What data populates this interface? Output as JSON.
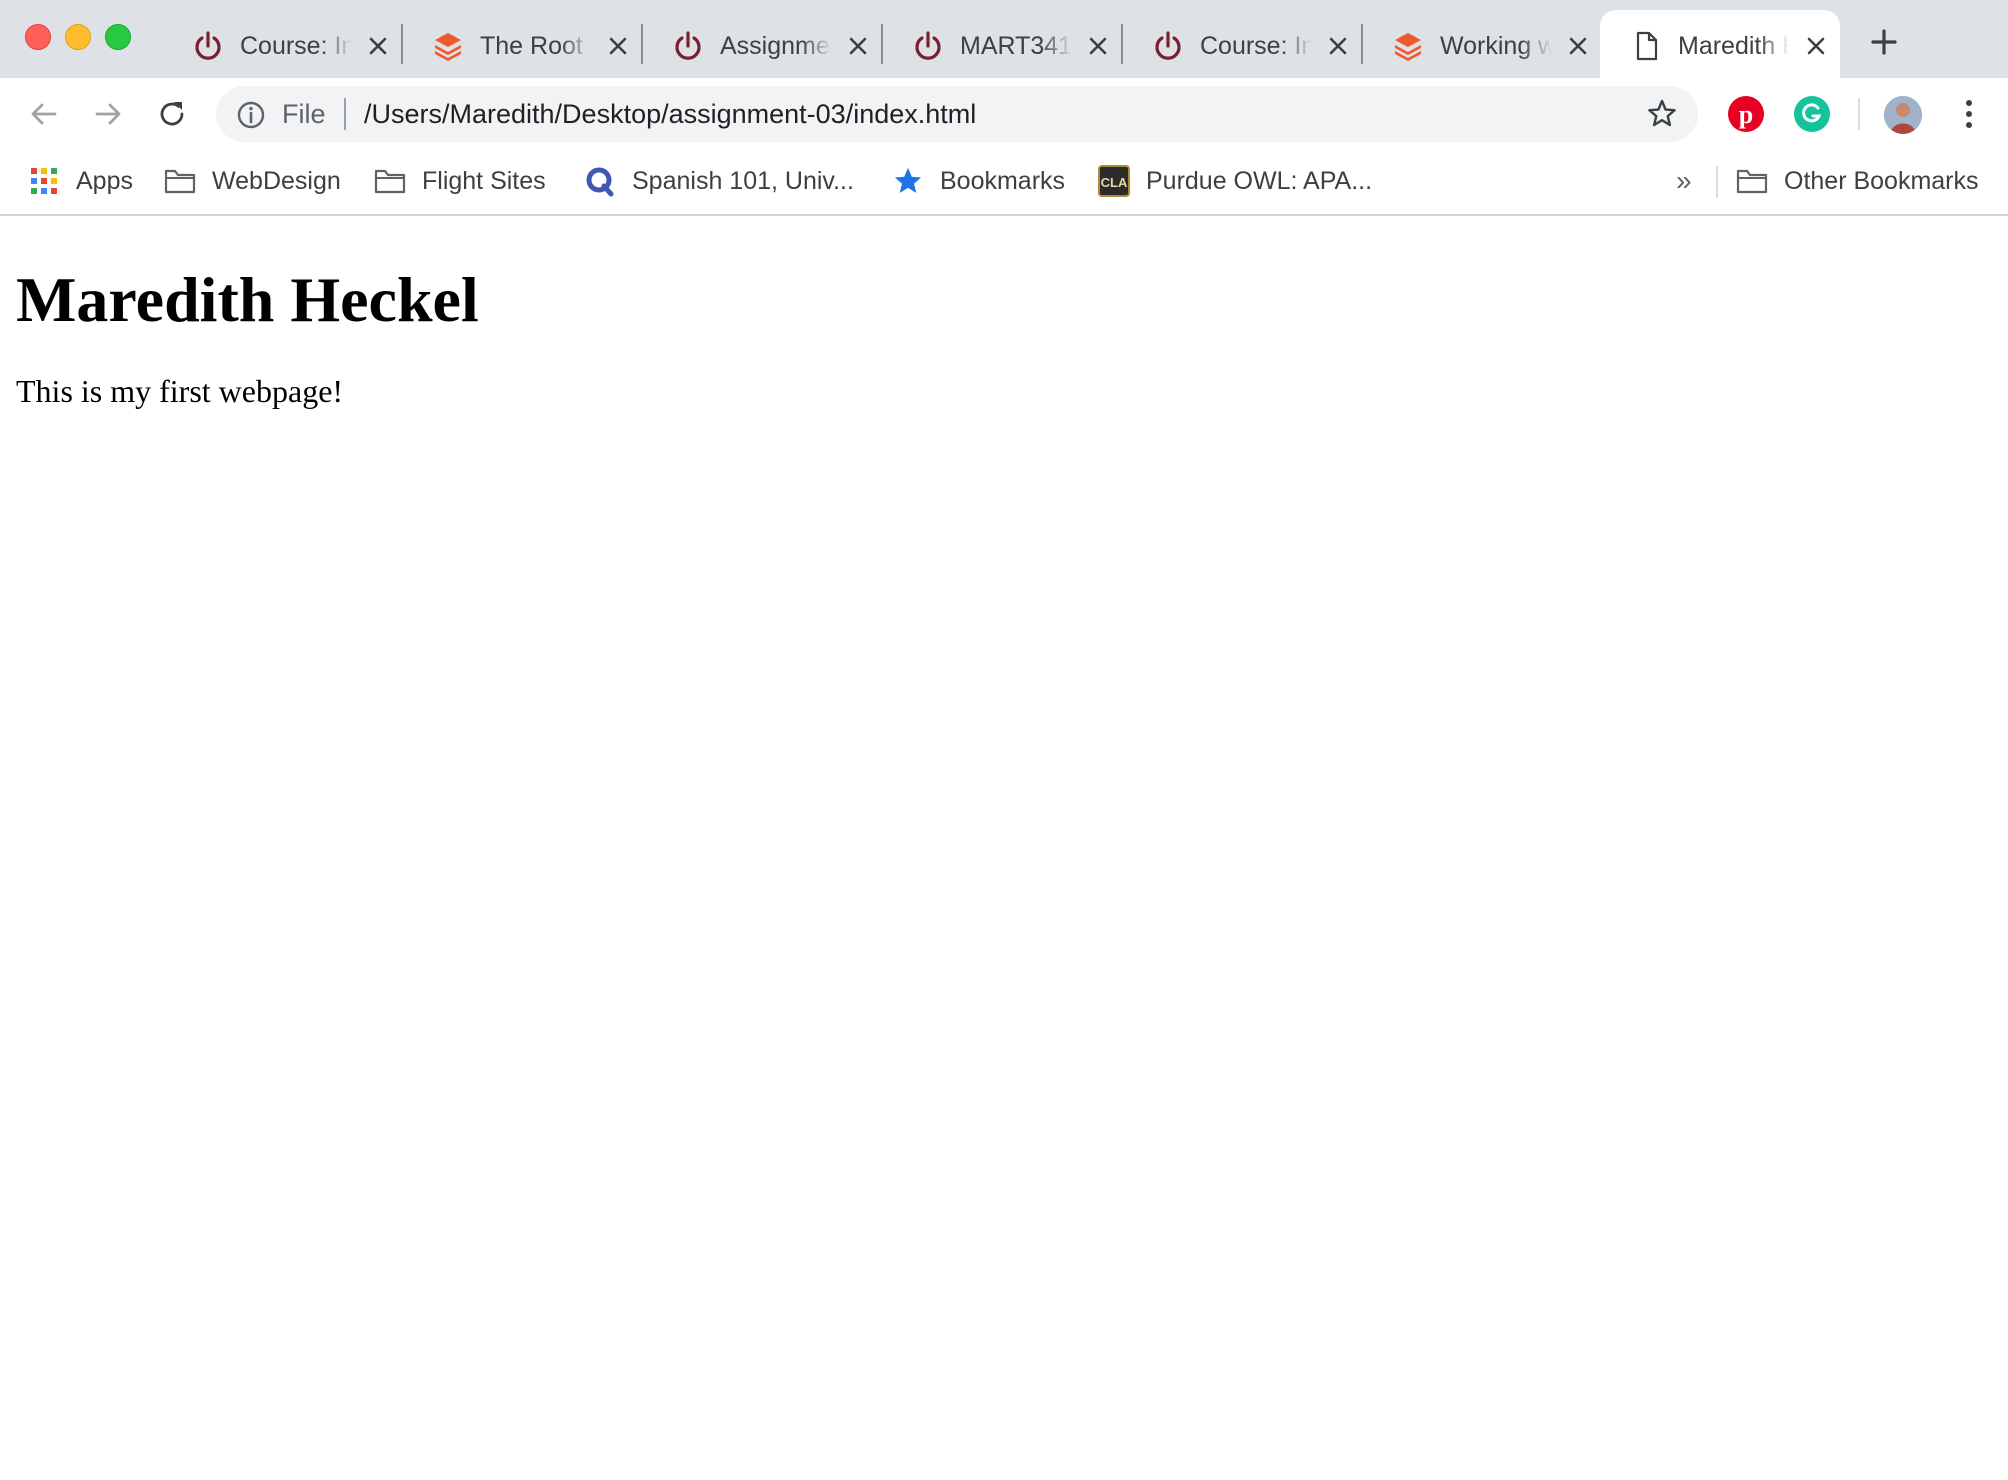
{
  "window": {
    "controls": [
      "close",
      "minimize",
      "zoom"
    ]
  },
  "tabs": [
    {
      "title": "Course: Introduction",
      "icon": "power-icon",
      "active": false
    },
    {
      "title": "The Root Folder",
      "icon": "layers-icon",
      "active": false
    },
    {
      "title": "Assignment",
      "icon": "power-icon",
      "active": false
    },
    {
      "title": "MART341",
      "icon": "power-icon",
      "active": false
    },
    {
      "title": "Course: Introduction",
      "icon": "power-icon",
      "active": false
    },
    {
      "title": "Working with",
      "icon": "layers-icon",
      "active": false
    },
    {
      "title": "Maredith Heckel",
      "icon": "document-icon",
      "active": true
    }
  ],
  "toolbar": {
    "scheme_label": "File",
    "url": "/Users/Maredith/Desktop/assignment-03/index.html",
    "extensions": [
      "pinterest-icon",
      "grammarly-icon"
    ]
  },
  "bookmarks": {
    "items": [
      {
        "label": "Apps",
        "icon": "apps-grid-icon"
      },
      {
        "label": "WebDesign",
        "icon": "folder-icon"
      },
      {
        "label": "Flight Sites",
        "icon": "folder-icon"
      },
      {
        "label": "Spanish 101, Univ...",
        "icon": "quizlet-icon"
      },
      {
        "label": "Bookmarks",
        "icon": "star-icon"
      },
      {
        "label": "Purdue OWL: APA...",
        "icon": "cla-icon"
      }
    ],
    "overflow": "»",
    "other": {
      "label": "Other Bookmarks",
      "icon": "folder-icon"
    }
  },
  "page": {
    "heading": "Maredith Heckel",
    "paragraph": "This is my first webpage!"
  },
  "colors": {
    "tabstrip_bg": "#dee1e6",
    "omnibox_bg": "#f1f3f4",
    "power_icon": "#7a1f2b",
    "layers_icon": "#f05a28",
    "pinterest": "#e60023",
    "grammarly": "#15c39a",
    "star_bookmark": "#1a73e8"
  }
}
